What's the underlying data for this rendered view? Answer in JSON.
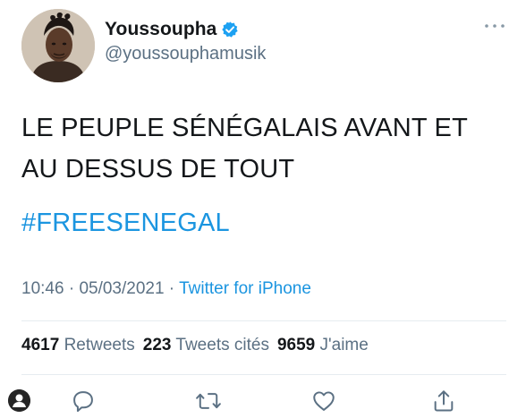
{
  "author": {
    "display_name": "Youssoupha",
    "handle": "@youssouphamusik",
    "verified": true,
    "avatar_icon": "profile-photo"
  },
  "tweet": {
    "text_line_1": "LE PEUPLE SÉNÉGALAIS AVANT ET",
    "text_line_2": "AU DESSUS DE TOUT",
    "hashtag": "#FREESENEGAL"
  },
  "meta": {
    "time": "10:46",
    "sep1": " · ",
    "date": "05/03/2021",
    "sep2": " · ",
    "source": "Twitter for iPhone"
  },
  "stats": {
    "retweets_count": "4617",
    "retweets_label": "Retweets",
    "quotes_count": "223",
    "quotes_label": "Tweets cités",
    "likes_count": "9659",
    "likes_label": "J'aime"
  },
  "actions": {
    "reply_icon": "reply-icon",
    "retweet_icon": "retweet-icon",
    "like_icon": "like-icon",
    "share_icon": "share-icon"
  },
  "colors": {
    "link": "#1b95e0",
    "secondary_text": "#5b7083",
    "primary_text": "#14171a",
    "verified_badge": "#1da1f2"
  }
}
